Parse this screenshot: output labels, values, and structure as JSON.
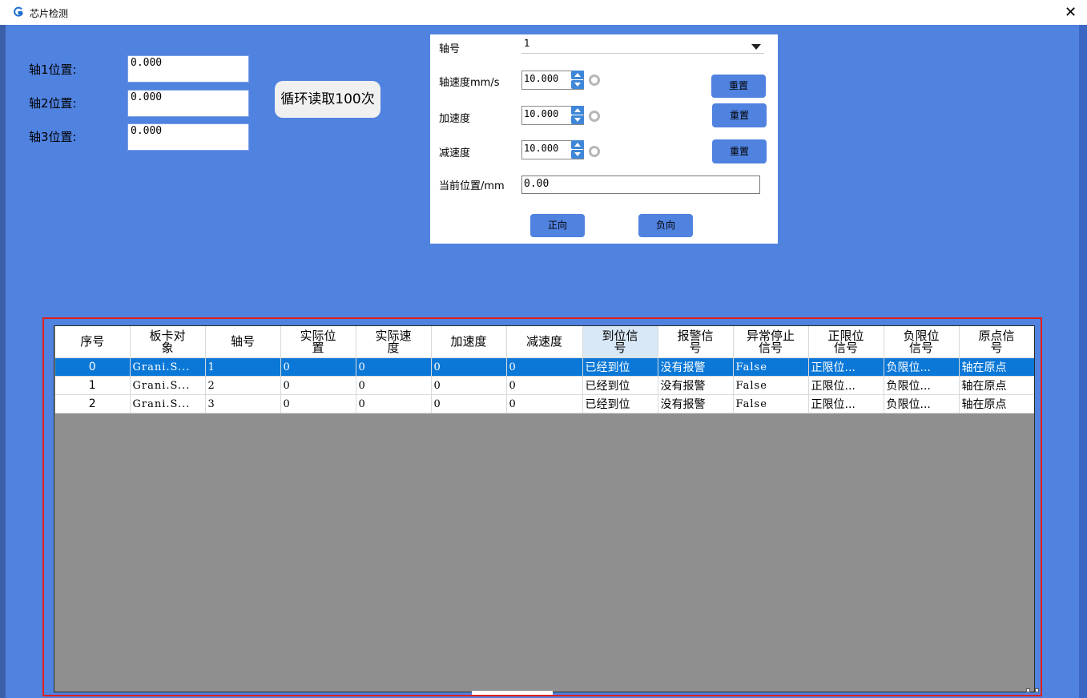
{
  "window": {
    "title": "芯片检测",
    "close_glyph": "✕"
  },
  "positions": [
    {
      "label": "轴1位置:",
      "value": "0.000"
    },
    {
      "label": "轴2位置:",
      "value": "0.000"
    },
    {
      "label": "轴3位置:",
      "value": "0.000"
    }
  ],
  "loop_button": "循环读取100次",
  "panel": {
    "axis_label": "轴号",
    "axis_value": "1",
    "speed_label": "轴速度mm/s",
    "speed_value": "10.000",
    "accel_label": "加速度",
    "accel_value": "10.000",
    "decel_label": "减速度",
    "decel_value": "10.000",
    "reset_label": "重置",
    "curpos_label": "当前位置/mm",
    "curpos_value": "0.00",
    "forward_label": "正向",
    "reverse_label": "负向"
  },
  "grid": {
    "columns": [
      "序号",
      "板卡对象",
      "轴号",
      "实际位置",
      "实际速度",
      "加速度",
      "减速度",
      "到位信号",
      "报警信号",
      "异常停止信号",
      "正限位信号",
      "负限位信号",
      "原点信号"
    ],
    "rows": [
      [
        "0",
        "Grani.S...",
        "1",
        "0",
        "0",
        "0",
        "0",
        "已经到位",
        "没有报警",
        "False",
        "正限位...",
        "负限位...",
        "轴在原点"
      ],
      [
        "1",
        "Grani.S...",
        "2",
        "0",
        "0",
        "0",
        "0",
        "已经到位",
        "没有报警",
        "False",
        "正限位...",
        "负限位...",
        "轴在原点"
      ],
      [
        "2",
        "Grani.S...",
        "3",
        "0",
        "0",
        "0",
        "0",
        "已经到位",
        "没有报警",
        "False",
        "正限位...",
        "负限位...",
        "轴在原点"
      ]
    ],
    "selected_row": 0
  },
  "colors": {
    "background": "#5082e0",
    "selection": "#0b78d7",
    "highlight_border": "#e0201c",
    "grid_empty": "#8f8f8f"
  }
}
